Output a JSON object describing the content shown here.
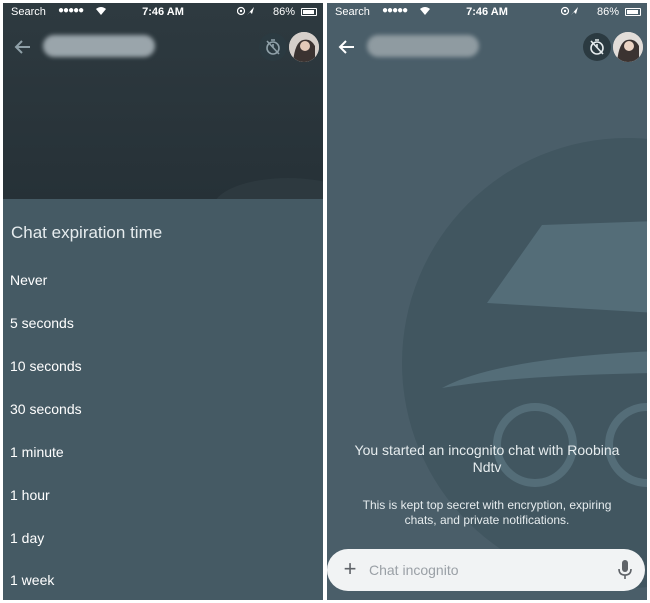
{
  "status_bar": {
    "carrier": "Search",
    "signal": "●●●●●",
    "time": "7:46 AM",
    "battery": "86%"
  },
  "left": {
    "sheet_title": "Chat expiration time",
    "options": [
      "Never",
      "5 seconds",
      "10 seconds",
      "30 seconds",
      "1 minute",
      "1 hour",
      "1 day",
      "1 week"
    ]
  },
  "right": {
    "intro_text": "You started an incognito chat with Roobina Ndtv",
    "sub_text": "This is kept top secret with encryption, expiring chats, and private notifications.",
    "compose_placeholder": "Chat incognito"
  },
  "icons": {
    "back": "arrow-left-icon",
    "timer": "timer-off-icon",
    "add": "plus-icon",
    "mic": "microphone-icon",
    "wifi": "wifi-icon",
    "location": "location-arrow-icon"
  },
  "colors": {
    "sheet_bg": "#455a64",
    "dim_header": "#2a353b",
    "incognito_bg": "#4a5e69",
    "compose_bg": "#f1f3f4"
  }
}
